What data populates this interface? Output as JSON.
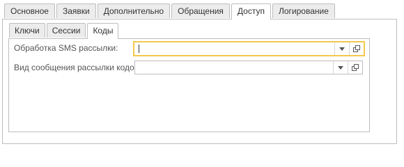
{
  "main_tabs": [
    {
      "label": "Основное",
      "active": false
    },
    {
      "label": "Заявки",
      "active": false
    },
    {
      "label": "Дополнительно",
      "active": false
    },
    {
      "label": "Обращения",
      "active": false
    },
    {
      "label": "Доступ",
      "active": true
    },
    {
      "label": "Логирование",
      "active": false
    }
  ],
  "sub_tabs": [
    {
      "label": "Ключи",
      "active": false
    },
    {
      "label": "Сессии",
      "active": false
    },
    {
      "label": "Коды",
      "active": true
    }
  ],
  "form": {
    "sms_processing": {
      "label": "Обработка SMS рассылки:",
      "value": ""
    },
    "code_message_type": {
      "label": "Вид сообщения рассылки кодов:",
      "value": ""
    }
  },
  "colors": {
    "focus_border": "#f2c94c",
    "tab_border": "#bdbdbd",
    "tab_bg": "#ececec"
  },
  "icons": {
    "dropdown": "chevron-down-icon",
    "open": "open-window-icon"
  }
}
